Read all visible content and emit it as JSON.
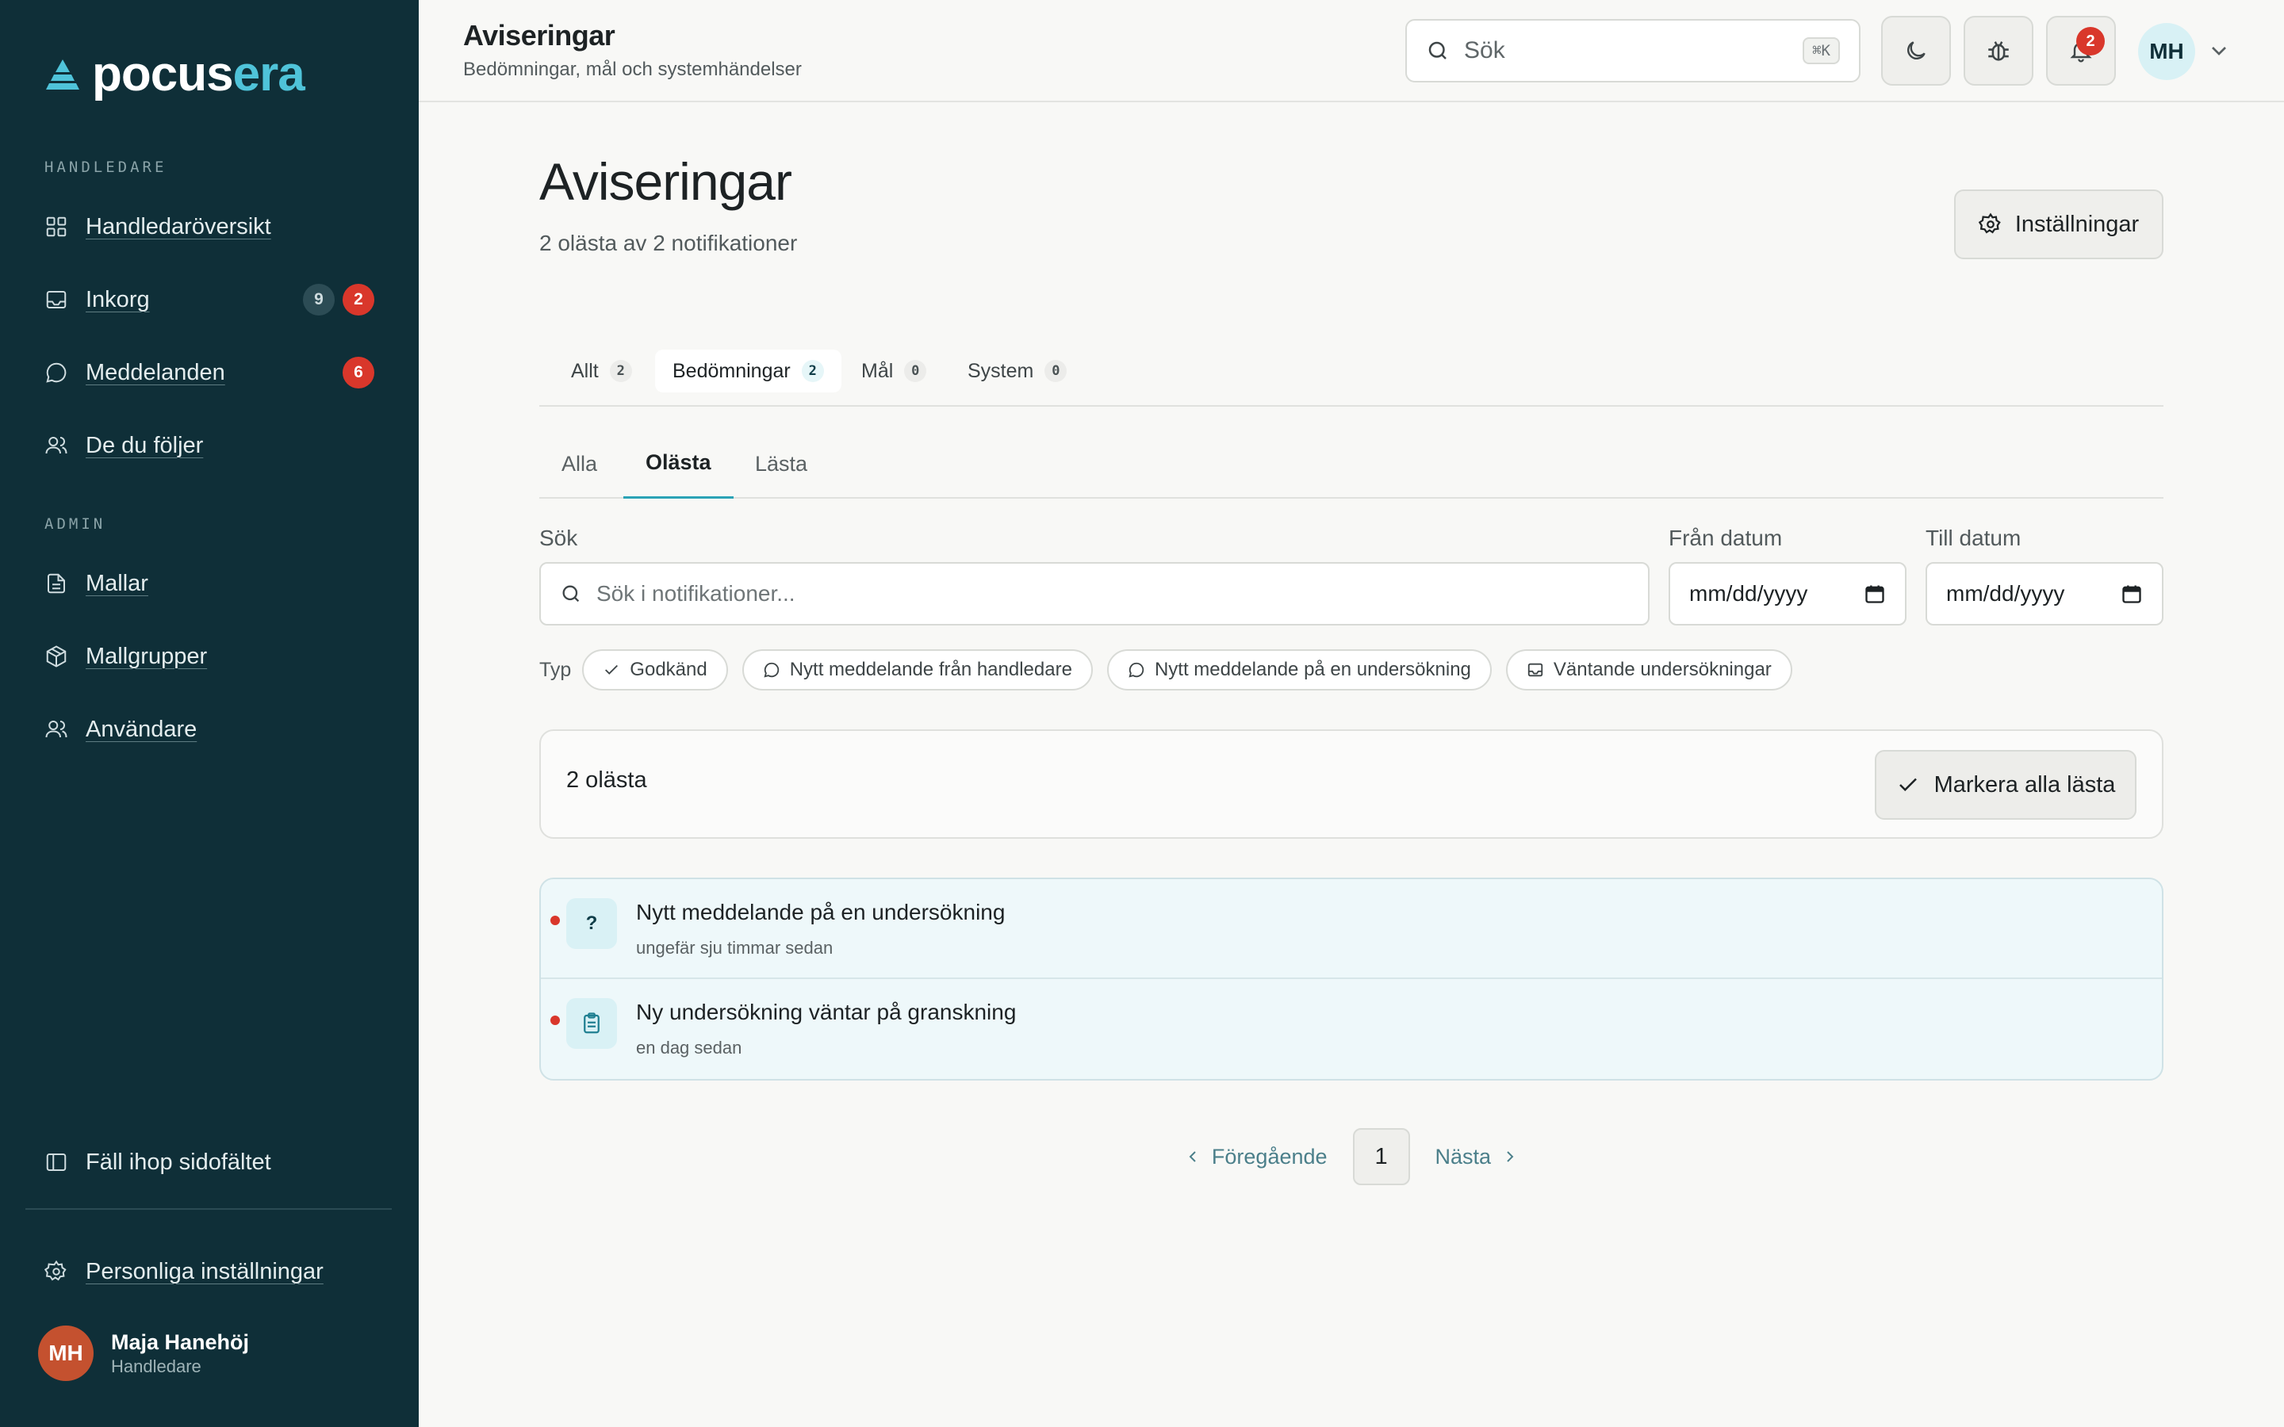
{
  "app": {
    "logo_part1": "pocus",
    "logo_part2": "era"
  },
  "sidebar": {
    "section_supervisor": "HANDLEDARE",
    "section_admin": "ADMIN",
    "items": [
      {
        "label": "Handledaröversikt",
        "icon": "grid-icon"
      },
      {
        "label": "Inkorg",
        "icon": "inbox-icon",
        "badge_gray": "9",
        "badge_red": "2"
      },
      {
        "label": "Meddelanden",
        "icon": "chat-icon",
        "badge_red": "6"
      },
      {
        "label": "De du följer",
        "icon": "users-icon"
      },
      {
        "label": "Mallar",
        "icon": "document-icon"
      },
      {
        "label": "Mallgrupper",
        "icon": "package-icon"
      },
      {
        "label": "Användare",
        "icon": "users-icon"
      }
    ],
    "collapse_label": "Fäll ihop sidofältet",
    "personal_settings": "Personliga inställningar",
    "user": {
      "initials": "MH",
      "name": "Maja Hanehöj",
      "role": "Handledare"
    }
  },
  "topbar": {
    "title": "Aviseringar",
    "subtitle": "Bedömningar, mål och systemhändelser",
    "search_placeholder": "Sök",
    "shortcut": "⌘K",
    "notification_count": "2",
    "avatar_initials": "MH"
  },
  "main": {
    "title": "Aviseringar",
    "subtitle": "2 olästa av 2 notifikationer",
    "settings_label": "Inställningar",
    "category_tabs": [
      {
        "label": "Allt",
        "count": "2"
      },
      {
        "label": "Bedömningar",
        "count": "2"
      },
      {
        "label": "Mål",
        "count": "0"
      },
      {
        "label": "System",
        "count": "0"
      }
    ],
    "read_tabs": [
      "Alla",
      "Olästa",
      "Lästa"
    ],
    "filters": {
      "search_label": "Sök",
      "search_placeholder": "Sök i notifikationer...",
      "from_label": "Från datum",
      "to_label": "Till datum",
      "from_value": "mm/dd/yyyy",
      "to_value": "mm/dd/yyyy",
      "type_label": "Typ",
      "type_chips": [
        "Godkänd",
        "Nytt meddelande från handledare",
        "Nytt meddelande på en undersökning",
        "Väntande undersökningar"
      ]
    },
    "summary": {
      "unread_text": "2 olästa",
      "mark_all_label": "Markera alla lästa"
    },
    "notifications": [
      {
        "title": "Nytt meddelande på en undersökning",
        "time": "ungefär sju timmar sedan",
        "icon": "?"
      },
      {
        "title": "Ny undersökning väntar på granskning",
        "time": "en dag sedan",
        "icon": "clipboard-icon"
      }
    ],
    "pagination": {
      "prev": "Föregående",
      "current": "1",
      "next": "Nästa"
    }
  },
  "colors": {
    "sidebar_bg": "#0f2f38",
    "accent": "#4fc3d9",
    "badge_red": "#d9372b"
  }
}
